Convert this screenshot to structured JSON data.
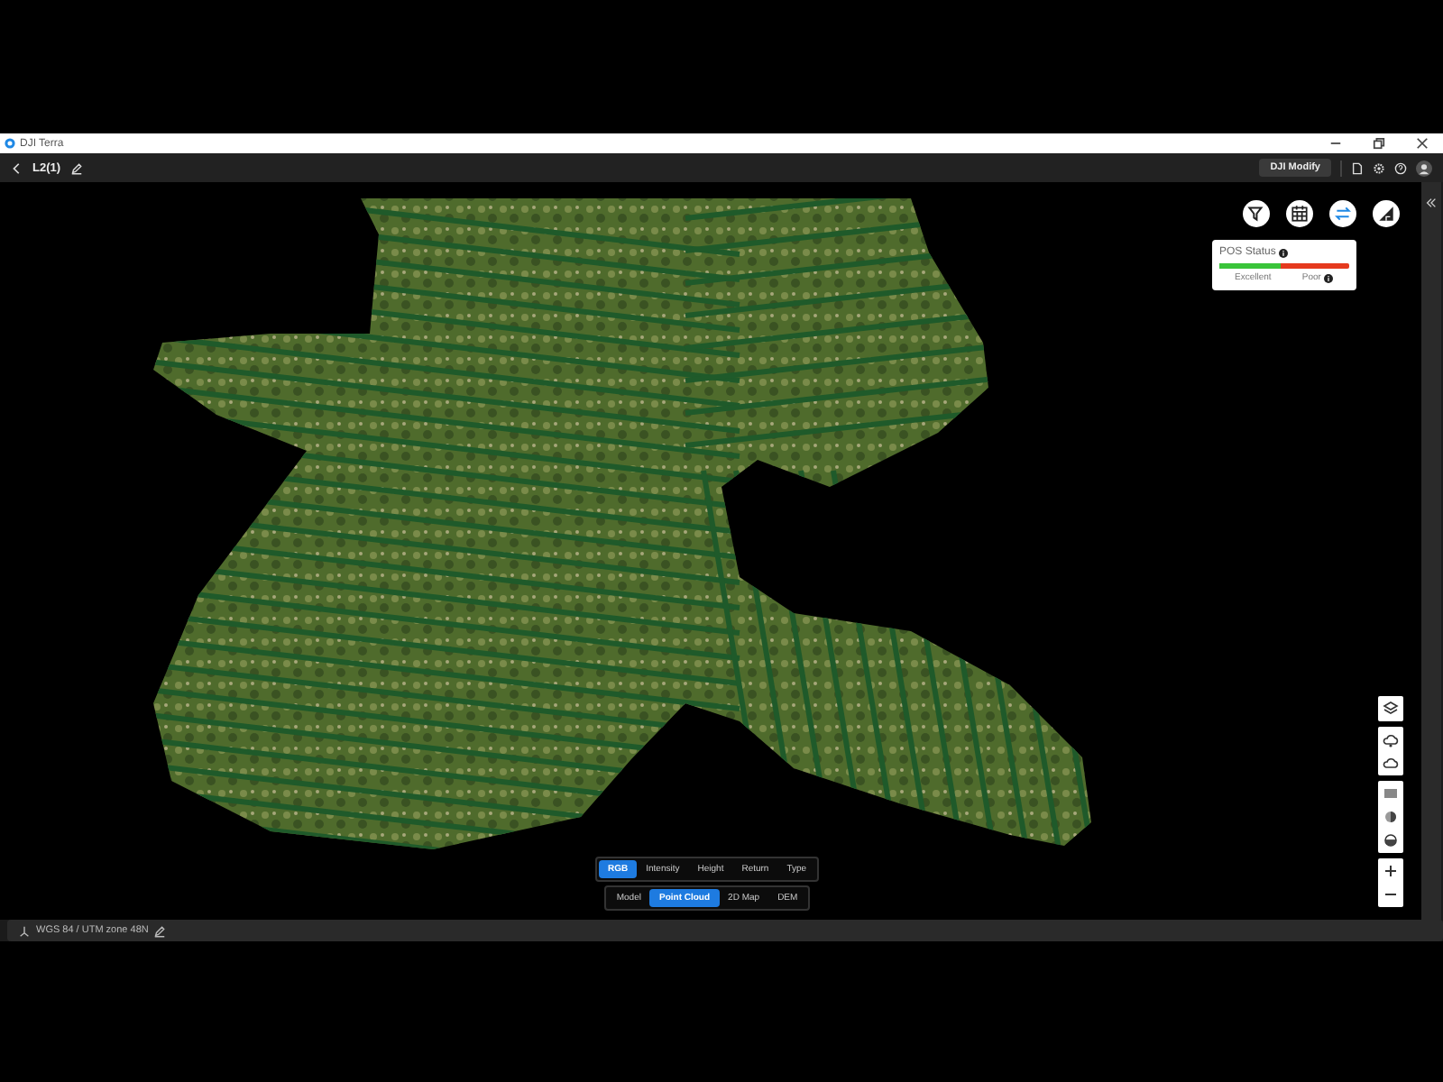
{
  "window": {
    "title": "DJI Terra"
  },
  "header": {
    "title": "L2(1)",
    "modify_button": "DJI Modify"
  },
  "tools": [
    {
      "kind": "filter",
      "selected": false
    },
    {
      "kind": "grid",
      "selected": false
    },
    {
      "kind": "swap",
      "selected": true
    },
    {
      "kind": "ruler",
      "selected": false
    }
  ],
  "pos_status": {
    "title": "POS Status",
    "good_label": "Excellent",
    "bad_label": "Poor",
    "level": 0.47
  },
  "color_modes": [
    {
      "label": "RGB",
      "selected": true
    },
    {
      "label": "Intensity",
      "selected": false
    },
    {
      "label": "Height",
      "selected": false
    },
    {
      "label": "Return",
      "selected": false
    },
    {
      "label": "Type",
      "selected": false
    }
  ],
  "views": [
    {
      "label": "Model",
      "selected": false
    },
    {
      "label": "Point Cloud",
      "selected": true
    },
    {
      "label": "2D Map",
      "selected": false
    },
    {
      "label": "DEM",
      "selected": false
    }
  ],
  "status_bar": {
    "crs": "WGS 84 / UTM zone 48N"
  }
}
